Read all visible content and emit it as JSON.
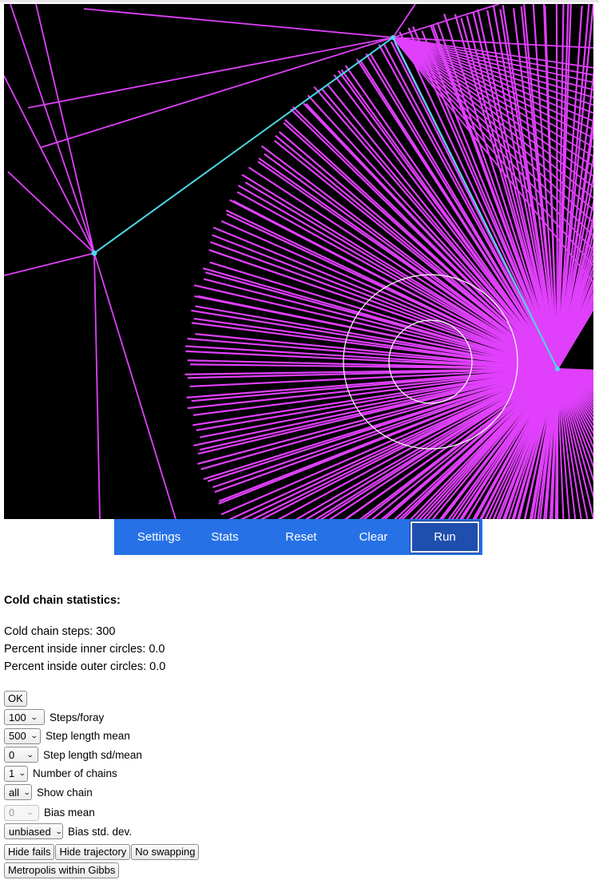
{
  "nav": {
    "settings": "Settings",
    "stats": "Stats",
    "reset": "Reset",
    "clear": "Clear",
    "run": "Run"
  },
  "stats": {
    "title": "Cold chain statistics:",
    "steps": "Cold chain steps: 300",
    "inner": "Percent inside inner circles: 0.0",
    "outer": "Percent inside outer circles: 0.0"
  },
  "controls": {
    "ok": "OK",
    "steps_per_foray": {
      "value": "100",
      "label": "Steps/foray"
    },
    "step_length_mean": {
      "value": "500",
      "label": "Step length mean"
    },
    "step_length_sd": {
      "value": "0",
      "label": "Step length sd/mean"
    },
    "num_chains": {
      "value": "1",
      "label": "Number of chains"
    },
    "show_chain": {
      "value": "all",
      "label": "Show chain"
    },
    "bias_mean": {
      "value": "0",
      "label": "Bias mean"
    },
    "bias_sd": {
      "value": "unbiased",
      "label": "Bias std. dev."
    },
    "hide_fails": "Hide fails",
    "hide_trajectory": "Hide trajectory",
    "no_swapping": "No swapping",
    "metropolis": "Metropolis within Gibbs"
  },
  "colors": {
    "canvas_bg": "#000000",
    "fail_line": "#e040fb",
    "trajectory": "#4dd9e6",
    "circle": "#ffffff",
    "navbar": "#2671e6",
    "run_active": "#1f4fae"
  },
  "icons": {
    "select_arrow": "chevron-down-icon"
  }
}
